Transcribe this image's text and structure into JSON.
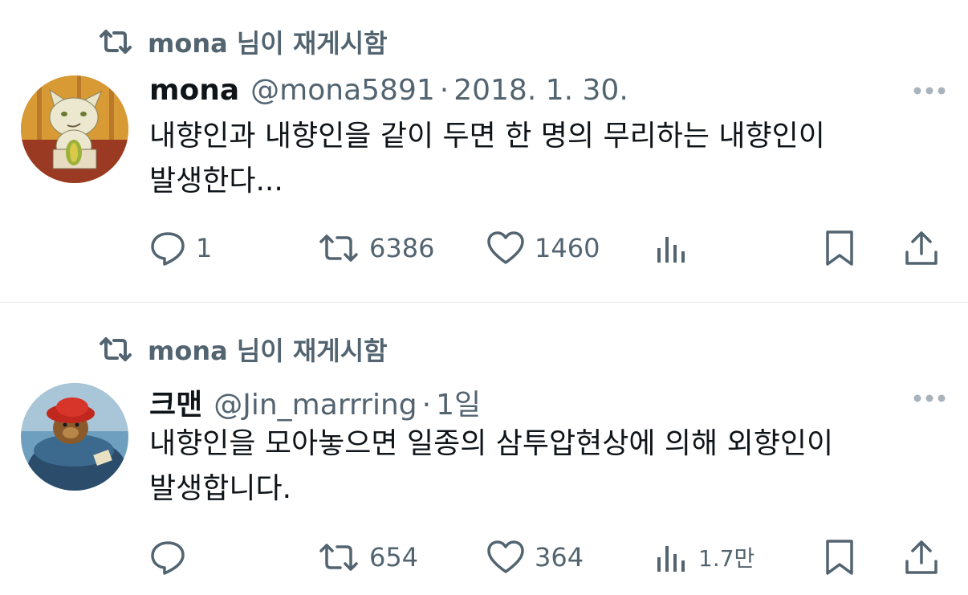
{
  "tweets": [
    {
      "retweet_label": "mona 님이 재게시함",
      "name": "mona",
      "handle": "@mona5891",
      "separator": "·",
      "date": "2018. 1. 30.",
      "text_lines": [
        "내향인과 내향인을 같이 두면 한 명의 무리하는 내향인이",
        "발생한다..."
      ],
      "reply_count": "1",
      "retweet_count": "6386",
      "like_count": "1460",
      "view_count": "",
      "avatar_icon": "cat-avatar-icon"
    },
    {
      "retweet_label": "mona 님이 재게시함",
      "name": "크맨",
      "handle": "@Jin_marrring",
      "separator": "·",
      "date": "1일",
      "text_lines": [
        "내향인을 모아놓으면 일종의 삼투압현상에 의해 외향인이",
        "발생합니다."
      ],
      "reply_count": "",
      "retweet_count": "654",
      "like_count": "364",
      "view_count": "1.7만",
      "avatar_icon": "bear-avatar-icon"
    }
  ],
  "colors": {
    "text": "#0f1419",
    "secondary": "#536471",
    "divider": "#e7e9ea"
  }
}
